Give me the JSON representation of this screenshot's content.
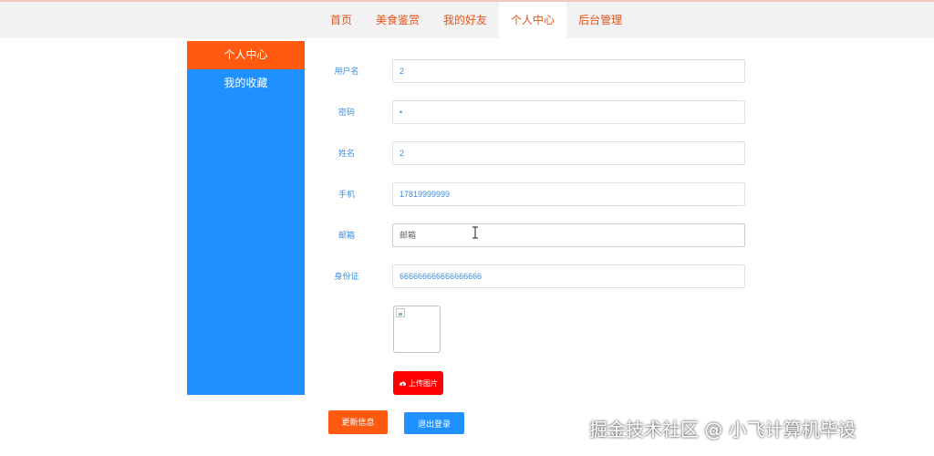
{
  "nav": {
    "items": [
      {
        "label": "首页"
      },
      {
        "label": "美食鉴赏"
      },
      {
        "label": "我的好友"
      },
      {
        "label": "个人中心"
      },
      {
        "label": "后台管理"
      }
    ],
    "active_index": 3
  },
  "sidebar": {
    "items": [
      {
        "label": "个人中心"
      },
      {
        "label": "我的收藏"
      }
    ],
    "active_index": 0
  },
  "form": {
    "username": {
      "label": "用户名",
      "value": "2"
    },
    "password": {
      "label": "密码",
      "value": "•"
    },
    "name": {
      "label": "姓名",
      "value": "2"
    },
    "phone": {
      "label": "手机",
      "value": "17819999999"
    },
    "email": {
      "label": "邮箱",
      "value": "",
      "placeholder": "邮箱"
    },
    "idcard": {
      "label": "身份证",
      "value": "666666666666666666"
    }
  },
  "upload": {
    "label": "上传图片",
    "icon": "cloud-upload-icon"
  },
  "actions": {
    "update_label": "更新信息",
    "logout_label": "退出登录"
  },
  "watermark": "掘金技术社区 @ 小飞计算机毕设",
  "colors": {
    "accent_orange": "#ff5a0f",
    "sidebar_blue": "#1e90ff",
    "upload_red": "#ff0000"
  }
}
